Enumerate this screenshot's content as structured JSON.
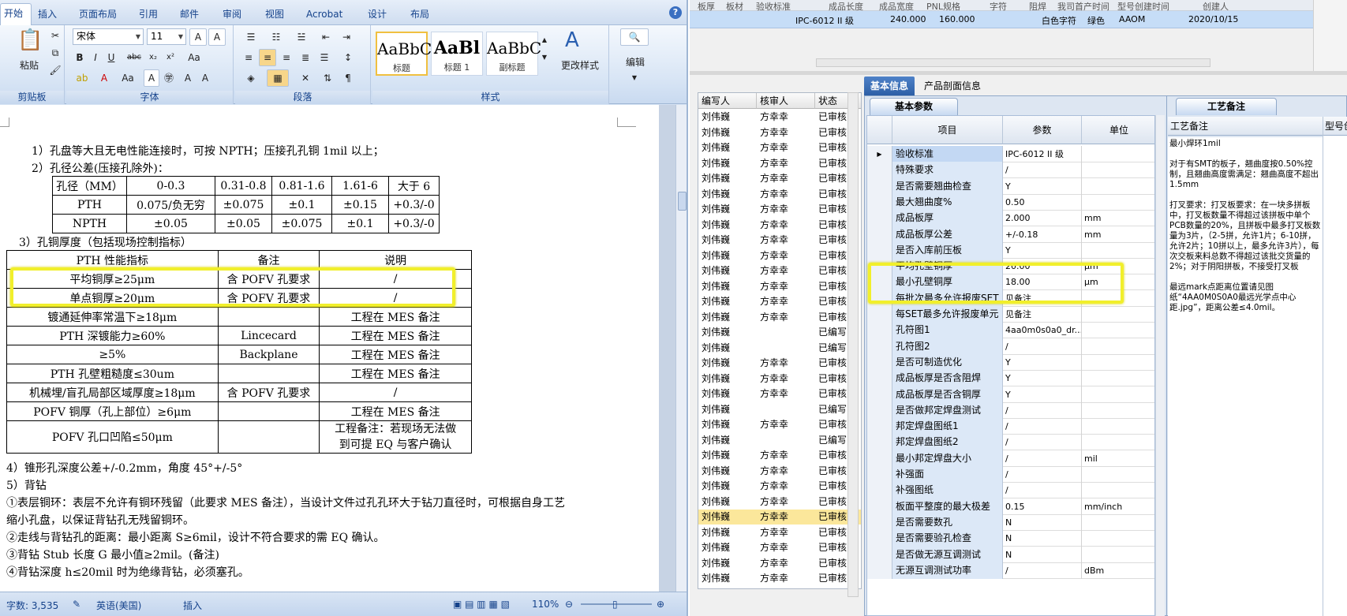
{
  "word": {
    "tabs": [
      "开始",
      "插入",
      "页面布局",
      "引用",
      "邮件",
      "审阅",
      "视图",
      "Acrobat",
      "设计",
      "布局"
    ],
    "help_icon": "?",
    "ribbon": {
      "paste_label": "粘贴",
      "font_name": "宋体",
      "font_size": "11",
      "group_clipboard": "剪贴板",
      "group_font": "字体",
      "group_paragraph": "段落",
      "group_styles": "样式",
      "styles": [
        {
          "sample": "AaBbC",
          "name": "标题"
        },
        {
          "sample": "AaBl",
          "name": "标题 1"
        },
        {
          "sample": "AaBbC",
          "name": "副标题"
        }
      ],
      "change_styles": "更改样式",
      "edit": "编辑"
    },
    "doc": {
      "line1": "1）孔盘等大且无电性能连接时，可按 NPTH；压接孔孔铜 1mil 以上；",
      "line2": "2）孔径公差(压接孔除外)：",
      "tol_table": [
        [
          "孔径（MM）",
          "0-0.3",
          "0.31-0.8",
          "0.81-1.6",
          "1.61-6",
          "大于 6"
        ],
        [
          "PTH",
          "0.075/负无穷",
          "±0.075",
          "±0.1",
          "±0.15",
          "+0.3/-0"
        ],
        [
          "NPTH",
          "±0.05",
          "±0.05",
          "±0.075",
          "±0.1",
          "+0.3/-0"
        ]
      ],
      "line3": "3）孔铜厚度（包括现场控制指标）",
      "cu_table": [
        [
          "PTH 性能指标",
          "备注",
          "说明"
        ],
        [
          "平均铜厚≥25μm",
          "含 POFV 孔要求",
          "/"
        ],
        [
          "单点铜厚≥20μm",
          "含 POFV 孔要求",
          "/"
        ],
        [
          "镀通延伸率常温下≥18μm",
          "",
          "工程在 MES 备注"
        ],
        [
          "PTH 深镀能力≥60%",
          "Lincecard",
          "工程在 MES 备注"
        ],
        [
          "≥5%",
          "Backplane",
          "工程在 MES 备注"
        ],
        [
          "PTH 孔壁粗糙度≤30um",
          "",
          "工程在 MES 备注"
        ],
        [
          "机械埋/盲孔局部区域厚度≥18μm",
          "含 POFV 孔要求",
          "/"
        ],
        [
          "POFV 铜厚（孔上部位）≥6μm",
          "",
          "工程在 MES 备注"
        ],
        [
          "POFV 孔口凹陷≤50μm",
          "",
          "工程备注：若现场无法做\n到可提 EQ 与客户确认"
        ]
      ],
      "line4": "4）锥形孔深度公差+/-0.2mm，角度 45°+/-5°",
      "line5": "5）背钻",
      "line6": "①表层铜环：表层不允许有铜环残留（此要求 MES 备注），当设计文件过孔孔环大于钻刀直径时，可根据自身工艺",
      "line7": "缩小孔盘，以保证背钻孔无残留铜环。",
      "line8": "②走线与背钻孔的距离：最小距离 S≥6mil，设计不符合要求的需 EQ 确认。",
      "line9": "③背钻 Stub 长度 G 最小值≥2mil。(备注)",
      "line10": "④背钻深度 h≤20mil 时为绝缘背钻，必须塞孔。"
    },
    "status": {
      "word_count": "字数: 3,535",
      "language": "英语(美国)",
      "insert_mode": "插入",
      "zoom": "110%"
    }
  },
  "erp": {
    "top_headers": [
      "板厚",
      "板材",
      "验收标准",
      "成品长度",
      "成品宽度",
      "PNL规格",
      "字符",
      "阻焊",
      "我司首产时间",
      "型号创建时间",
      "创建人"
    ],
    "selected_row": [
      "IPC-6012 II 级",
      "240.000",
      "160.000",
      "白色字符",
      "绿色",
      "AAOM",
      "2020/10/15"
    ],
    "list": {
      "headers": [
        "编写人",
        "核审人",
        "状态"
      ],
      "rows": [
        [
          "刘伟巍",
          "方幸幸",
          "已审核"
        ],
        [
          "刘伟巍",
          "方幸幸",
          "已审核"
        ],
        [
          "刘伟巍",
          "方幸幸",
          "已审核"
        ],
        [
          "刘伟巍",
          "方幸幸",
          "已审核"
        ],
        [
          "刘伟巍",
          "方幸幸",
          "已审核"
        ],
        [
          "刘伟巍",
          "方幸幸",
          "已审核"
        ],
        [
          "刘伟巍",
          "方幸幸",
          "已审核"
        ],
        [
          "刘伟巍",
          "方幸幸",
          "已审核"
        ],
        [
          "刘伟巍",
          "方幸幸",
          "已审核"
        ],
        [
          "刘伟巍",
          "方幸幸",
          "已审核"
        ],
        [
          "刘伟巍",
          "方幸幸",
          "已审核"
        ],
        [
          "刘伟巍",
          "方幸幸",
          "已审核"
        ],
        [
          "刘伟巍",
          "方幸幸",
          "已审核"
        ],
        [
          "刘伟巍",
          "方幸幸",
          "已审核"
        ],
        [
          "刘伟巍",
          "",
          "已编写"
        ],
        [
          "刘伟巍",
          "",
          "已编写"
        ],
        [
          "刘伟巍",
          "方幸幸",
          "已审核"
        ],
        [
          "刘伟巍",
          "方幸幸",
          "已审核"
        ],
        [
          "刘伟巍",
          "方幸幸",
          "已审核"
        ],
        [
          "刘伟巍",
          "",
          "已编写"
        ],
        [
          "刘伟巍",
          "方幸幸",
          "已审核"
        ],
        [
          "刘伟巍",
          "",
          "已编写"
        ],
        [
          "刘伟巍",
          "方幸幸",
          "已审核"
        ],
        [
          "刘伟巍",
          "方幸幸",
          "已审核"
        ],
        [
          "刘伟巍",
          "方幸幸",
          "已审核"
        ],
        [
          "刘伟巍",
          "方幸幸",
          "已审核"
        ],
        [
          "刘伟巍",
          "方幸幸",
          "已审核"
        ],
        [
          "刘伟巍",
          "方幸幸",
          "已审核"
        ],
        [
          "刘伟巍",
          "方幸幸",
          "已审核"
        ],
        [
          "刘伟巍",
          "方幸幸",
          "已审核"
        ],
        [
          "刘伟巍",
          "方幸幸",
          "已审核"
        ],
        [
          "刘伟巍",
          "方幸幸",
          "已审核"
        ],
        [
          "刘伟巍",
          "方幸幸",
          "已审核"
        ]
      ]
    },
    "panel_tabs": [
      "基本信息",
      "产品剖面信息"
    ],
    "sub_tab": "基本参数",
    "prop_headers": [
      "项目",
      "参数",
      "单位"
    ],
    "props": [
      [
        "验收标准",
        "IPC-6012 II 级",
        ""
      ],
      [
        "特殊要求",
        "/",
        ""
      ],
      [
        "是否需要翘曲检查",
        "Y",
        ""
      ],
      [
        "最大翘曲度%",
        "0.50",
        ""
      ],
      [
        "成品板厚",
        "2.000",
        "mm"
      ],
      [
        "成品板厚公差",
        "+/-0.18",
        "mm"
      ],
      [
        "是否入库前压板",
        "Y",
        ""
      ],
      [
        "平均孔壁铜厚",
        "20.00",
        "μm"
      ],
      [
        "最小孔壁铜厚",
        "18.00",
        "μm"
      ],
      [
        "每批次最多允许报废SET",
        "见备注",
        ""
      ],
      [
        "每SET最多允许报废单元",
        "见备注",
        ""
      ],
      [
        "孔符图1",
        "4aa0m0s0a0_dr...",
        ""
      ],
      [
        "孔符图2",
        "/",
        ""
      ],
      [
        "是否可制造优化",
        "Y",
        ""
      ],
      [
        "成品板厚是否含阻焊",
        "Y",
        ""
      ],
      [
        "成品板厚是否含铜厚",
        "Y",
        ""
      ],
      [
        "是否做邦定焊盘测试",
        "/",
        ""
      ],
      [
        "邦定焊盘图纸1",
        "/",
        ""
      ],
      [
        "邦定焊盘图纸2",
        "/",
        ""
      ],
      [
        "最小邦定焊盘大小",
        "/",
        "mil"
      ],
      [
        "补强面",
        "/",
        ""
      ],
      [
        "补强图纸",
        "/",
        ""
      ],
      [
        "板面平整度的最大极差",
        "0.15",
        "mm/inch"
      ],
      [
        "是否需要数孔",
        "N",
        ""
      ],
      [
        "是否需要验孔检查",
        "N",
        ""
      ],
      [
        "是否做无源互调测试",
        "N",
        ""
      ],
      [
        "无源互调测试功率",
        "/",
        "dBm"
      ]
    ],
    "notes_tab": "工艺备注",
    "notes_header": "工艺备注",
    "notes_text": "最小焊环1mil\n\n对于有SMT的板子，翘曲度按0.50%控制，且翘曲高度需满足：翘曲高度不超出1.5mm\n\n打叉要求：打叉板要求：在一块多拼板中，打叉板数量不得超过该拼板中单个PCB数量的20%，且拼板中最多打叉板数量为3片，（2-5拼，允许1片；6-10拼，允许2片；10拼以上，最多允许3片），每次交板来料总数不得超过该批交货量的2%；对于阴阳拼板，不接受打叉板\n\n最远mark点距离位置请见图纸“4AA0M0S0A0最远光学点中心距.jpg”，距离公差≤4.0mil。",
    "right_col_header": "型号创"
  }
}
